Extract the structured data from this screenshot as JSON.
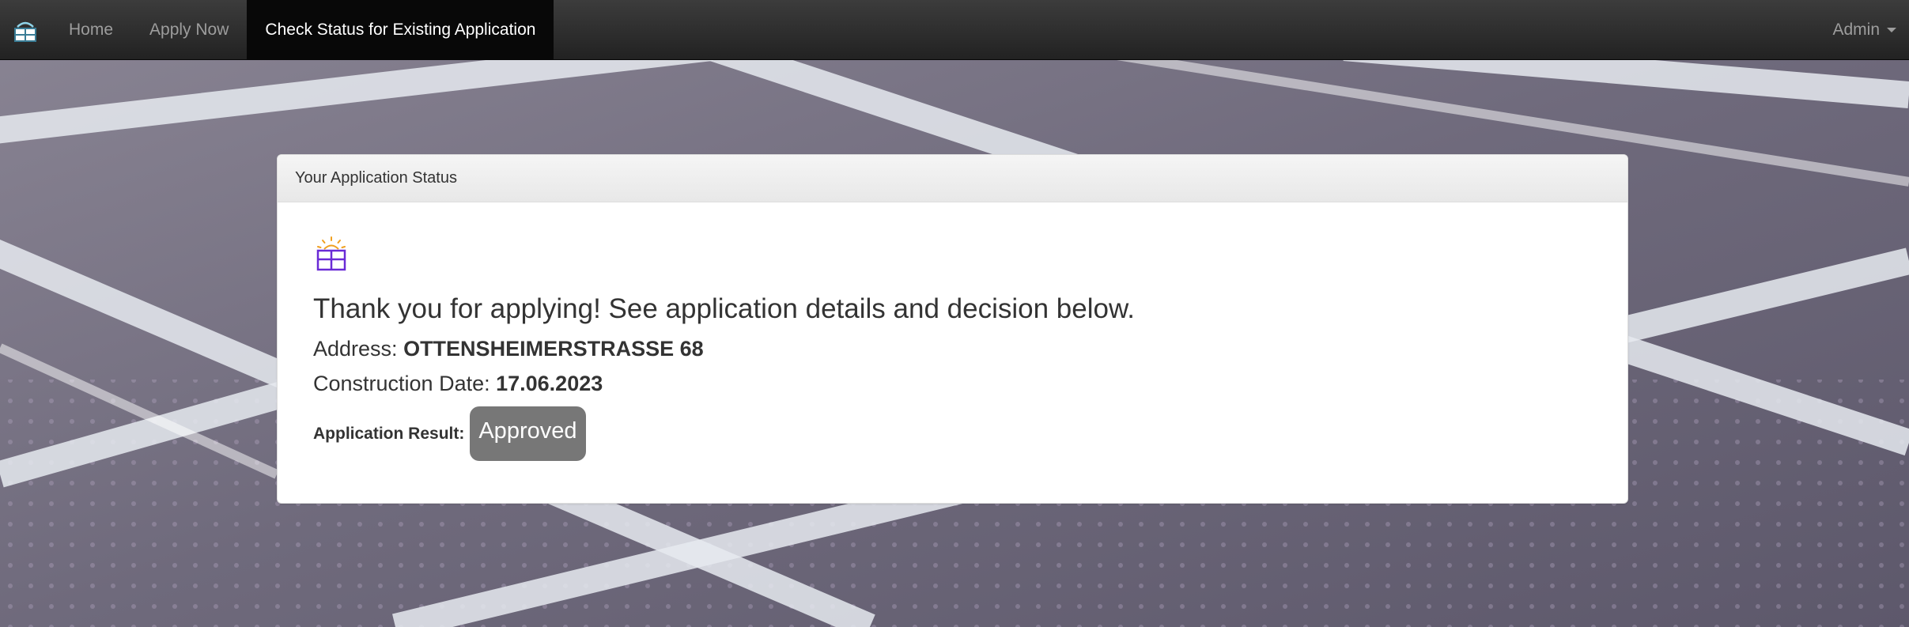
{
  "navbar": {
    "brand_icon": "solar-panel-icon",
    "links": [
      "Home",
      "Apply Now",
      "Check Status for Existing Application"
    ],
    "active_index": 2,
    "user_menu_label": "Admin"
  },
  "panel": {
    "heading": "Your Application Status",
    "icon": "solar-panel-sun-icon",
    "headline": "Thank you for applying! See application details and decision below.",
    "address_label": "Address: ",
    "address_value": "OTTENSHEIMERSTRASSE 68",
    "construction_label": "Construction Date: ",
    "construction_value": "17.06.2023",
    "result_label": "Application Result:",
    "result_value": "Approved"
  },
  "colors": {
    "navbar_bg": "#222222",
    "active_link_bg": "#080808",
    "badge_bg": "#777777",
    "icon_purple": "#6a2bd6",
    "icon_orange": "#f0a020"
  }
}
